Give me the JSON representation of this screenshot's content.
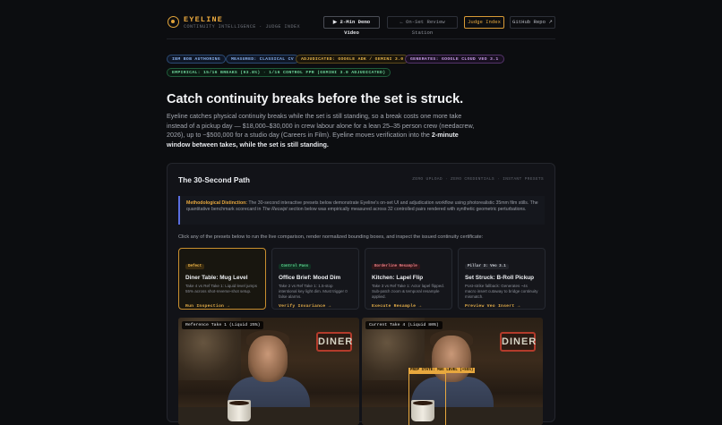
{
  "header": {
    "brand": "EYELINE",
    "tagline": "CONTINUITY INTELLIGENCE · JUDGE INDEX",
    "nav": {
      "demo": "▶ 2-Min Demo Video",
      "review": "← On-Set Review Station",
      "judge": "Judge Index",
      "github": "GitHub Repo ↗"
    }
  },
  "badges": [
    "IBM BOB AUTHORING",
    "MEASURED: CLASSICAL CV",
    "ADJUDICATED: GOOGLE ADK / GEMINI 3.0",
    "GENERATES: GOOGLE CLOUD VEO 3.1",
    "EMPIRICAL: 15/16 BREAKS (93.8%) · 1/16 CONTROL FPR (GEMINI 3.0 ADJUDICATED)"
  ],
  "hero": {
    "title": "Catch continuity breaks before the set is struck.",
    "lede": "Eyeline catches physical continuity breaks while the set is still standing, so a break costs one more take instead of a pickup day — $18,000–$30,000 in crew labour alone for a lean 25–35 person crew (needacrew, 2026), up to ~$500,000 for a studio day (Careers in Film). Eyeline moves verification into the ",
    "lede_bold": "2-minute window between takes, while the set is still standing."
  },
  "path": {
    "title": "The 30-Second Path",
    "tags": "ZERO UPLOAD · ZERO CREDENTIALS · INSTANT PRESETS",
    "note_label": "Methodological Distinction:",
    "note_text": " The 30-second interactive presets below demonstrate Eyeline's on-set UI and adjudication workflow using photorealistic 35mm film stills. The quantitative benchmark scorecard in ",
    "note_em": "The Receipt",
    "note_tail": " section below was empirically measured across 32 controlled pairs rendered with synthetic geometric perturbations.",
    "instruction": "Click any of the presets below to run the live comparison, render normalized bounding boxes, and inspect the issued continuity certificate:"
  },
  "presets": [
    {
      "tag": "Defect",
      "title": "Diner Table: Mug Level",
      "desc": "Take 4 vs Ref Take 1: Liquid level jumps 55% across shot-reverse-shot setup.",
      "link": "Run Inspection →"
    },
    {
      "tag": "Control Pass",
      "title": "Office Brief: Mood Dim",
      "desc": "Take 2 vs Ref Take 1: 1.5-stop intentional key light dim. Must trigger 0 false alarms.",
      "link": "Verify Invariance →"
    },
    {
      "tag": "Borderline Resample",
      "title": "Kitchen: Lapel Flip",
      "desc": "Take 3 vs Ref Take 1: Actor lapel flipped. Sub-patch zoom & temporal resample applied.",
      "link": "Execute Resample →"
    },
    {
      "tag": "Pillar 3: Veo 3.1",
      "title": "Set Struck: B-Roll Pickup",
      "desc": "Post-strike fallback: Generates ~4s macro insert cutaway to bridge continuity mismatch.",
      "link": "Preview Veo Insert →"
    }
  ],
  "shots": {
    "ref_caption": "Reference Take 1 (Liquid 25%)",
    "cur_caption": "Current Take 4 (Liquid 80%)",
    "sign_text": "DINER",
    "bbox_label": "PROP STATE: MUG LEVEL (+55%)"
  },
  "colors": {
    "accent": "#e8a83e",
    "background": "#0c0d10",
    "card": "#121318"
  }
}
